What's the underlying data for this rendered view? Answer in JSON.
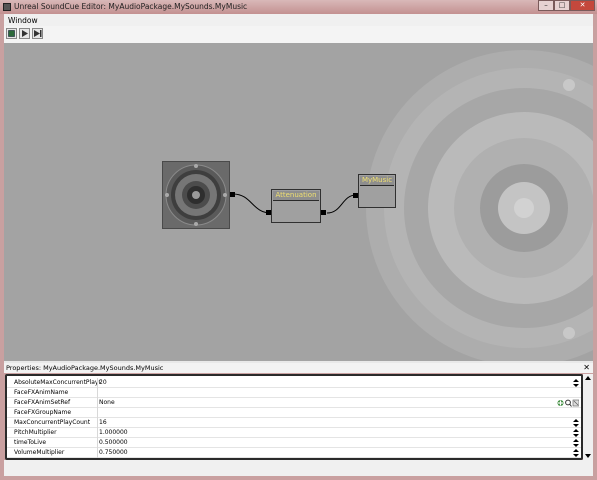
{
  "window": {
    "title": "Unreal SoundCue Editor: MyAudioPackage.MySounds.MyMusic",
    "min_glyph": "–",
    "max_glyph": "□",
    "close_glyph": "✕"
  },
  "menu": {
    "items": [
      "Window"
    ]
  },
  "toolbar": {
    "buttons": [
      {
        "icon": "stop-icon"
      },
      {
        "icon": "play-cue-icon"
      },
      {
        "icon": "play-node-icon"
      }
    ]
  },
  "graph": {
    "nodes": [
      {
        "id": "wave",
        "icon": "speaker-icon"
      },
      {
        "id": "attenuation",
        "title": "Attenuation"
      },
      {
        "id": "mymusic",
        "title": "MyMusic"
      }
    ]
  },
  "properties": {
    "title": "Properties: MyAudioPackage.MySounds.MyMusic",
    "close_glyph": "✕",
    "rows": [
      {
        "name": "AbsoluteMaxConcurrentPlayCount",
        "display_name": "AbsoluteMaxConcurrentPlayCou",
        "value": "20"
      },
      {
        "name": "FaceFXAnimName",
        "display_name": "FaceFXAnimName",
        "value": ""
      },
      {
        "name": "FaceFXAnimSetRef",
        "display_name": "FaceFXAnimSetRef",
        "value": "None"
      },
      {
        "name": "FaceFXGroupName",
        "display_name": "FaceFXGroupName",
        "value": ""
      },
      {
        "name": "MaxConcurrentPlayCount",
        "display_name": "MaxConcurrentPlayCount",
        "value": "16"
      },
      {
        "name": "PitchMultiplier",
        "display_name": "PitchMultiplier",
        "value": "1.000000"
      },
      {
        "name": "timeToLive",
        "display_name": "timeToLive",
        "value": "0.500000"
      },
      {
        "name": "VolumeMultiplier",
        "display_name": "VolumeMultiplier",
        "value": "0.750000"
      }
    ]
  },
  "colors": {
    "window_frame": "#c9a0a0",
    "canvas_bg": "#a3a3a3",
    "node_title_text": "#f0e070",
    "close_button": "#c4483c"
  }
}
